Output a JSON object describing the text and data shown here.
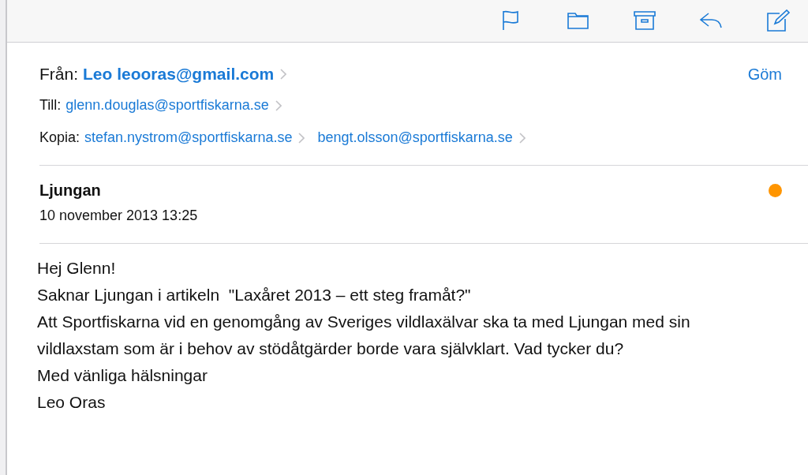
{
  "toolbar": {
    "buttons": [
      {
        "kind": "flag"
      },
      {
        "kind": "folder"
      },
      {
        "kind": "archive"
      },
      {
        "kind": "reply"
      },
      {
        "kind": "compose"
      }
    ]
  },
  "header": {
    "from": {
      "label": "Från:",
      "sender": "Leo leooras@gmail.com"
    },
    "hide_link": "Göm",
    "to": {
      "label": "Till:",
      "addresses": [
        "glenn.douglas@sportfiskarna.se"
      ]
    },
    "cc": {
      "label": "Kopia:",
      "addresses": [
        "stefan.nystrom@sportfiskarna.se",
        "bengt.olsson@sportfiskarna.se"
      ]
    }
  },
  "message": {
    "subject": "Ljungan",
    "date": "10 november 2013 13:25",
    "flagged": true,
    "color": "#ff9500"
  },
  "body": [
    "Hej Glenn!",
    "Saknar Ljungan i artikeln  \"Laxåret 2013 – ett steg framåt?\"",
    "Att Sportfiskarna vid en genomgång av Sveriges vildlaxälvar ska ta med Ljungan med sin vildlaxstam som är i behov av stödåtgärder borde vara självklart. Vad tycker du?",
    "Med vänliga hälsningar",
    "Leo Oras"
  ]
}
